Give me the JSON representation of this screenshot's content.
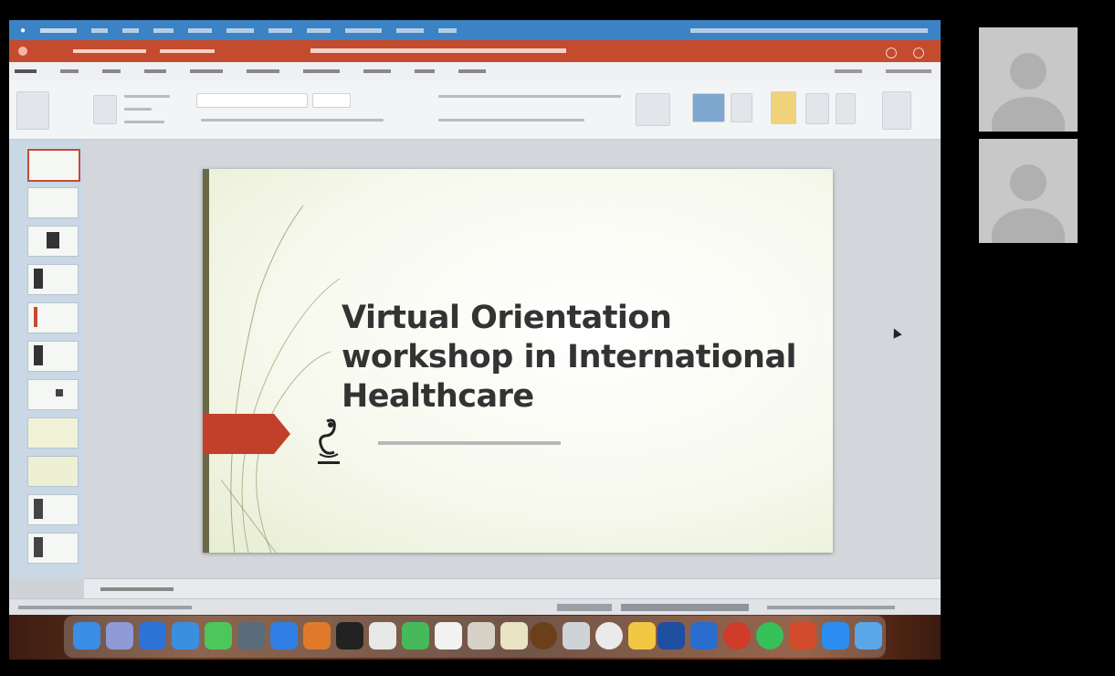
{
  "slide": {
    "title": "Virtual Orientation workshop in International Healthcare"
  }
}
